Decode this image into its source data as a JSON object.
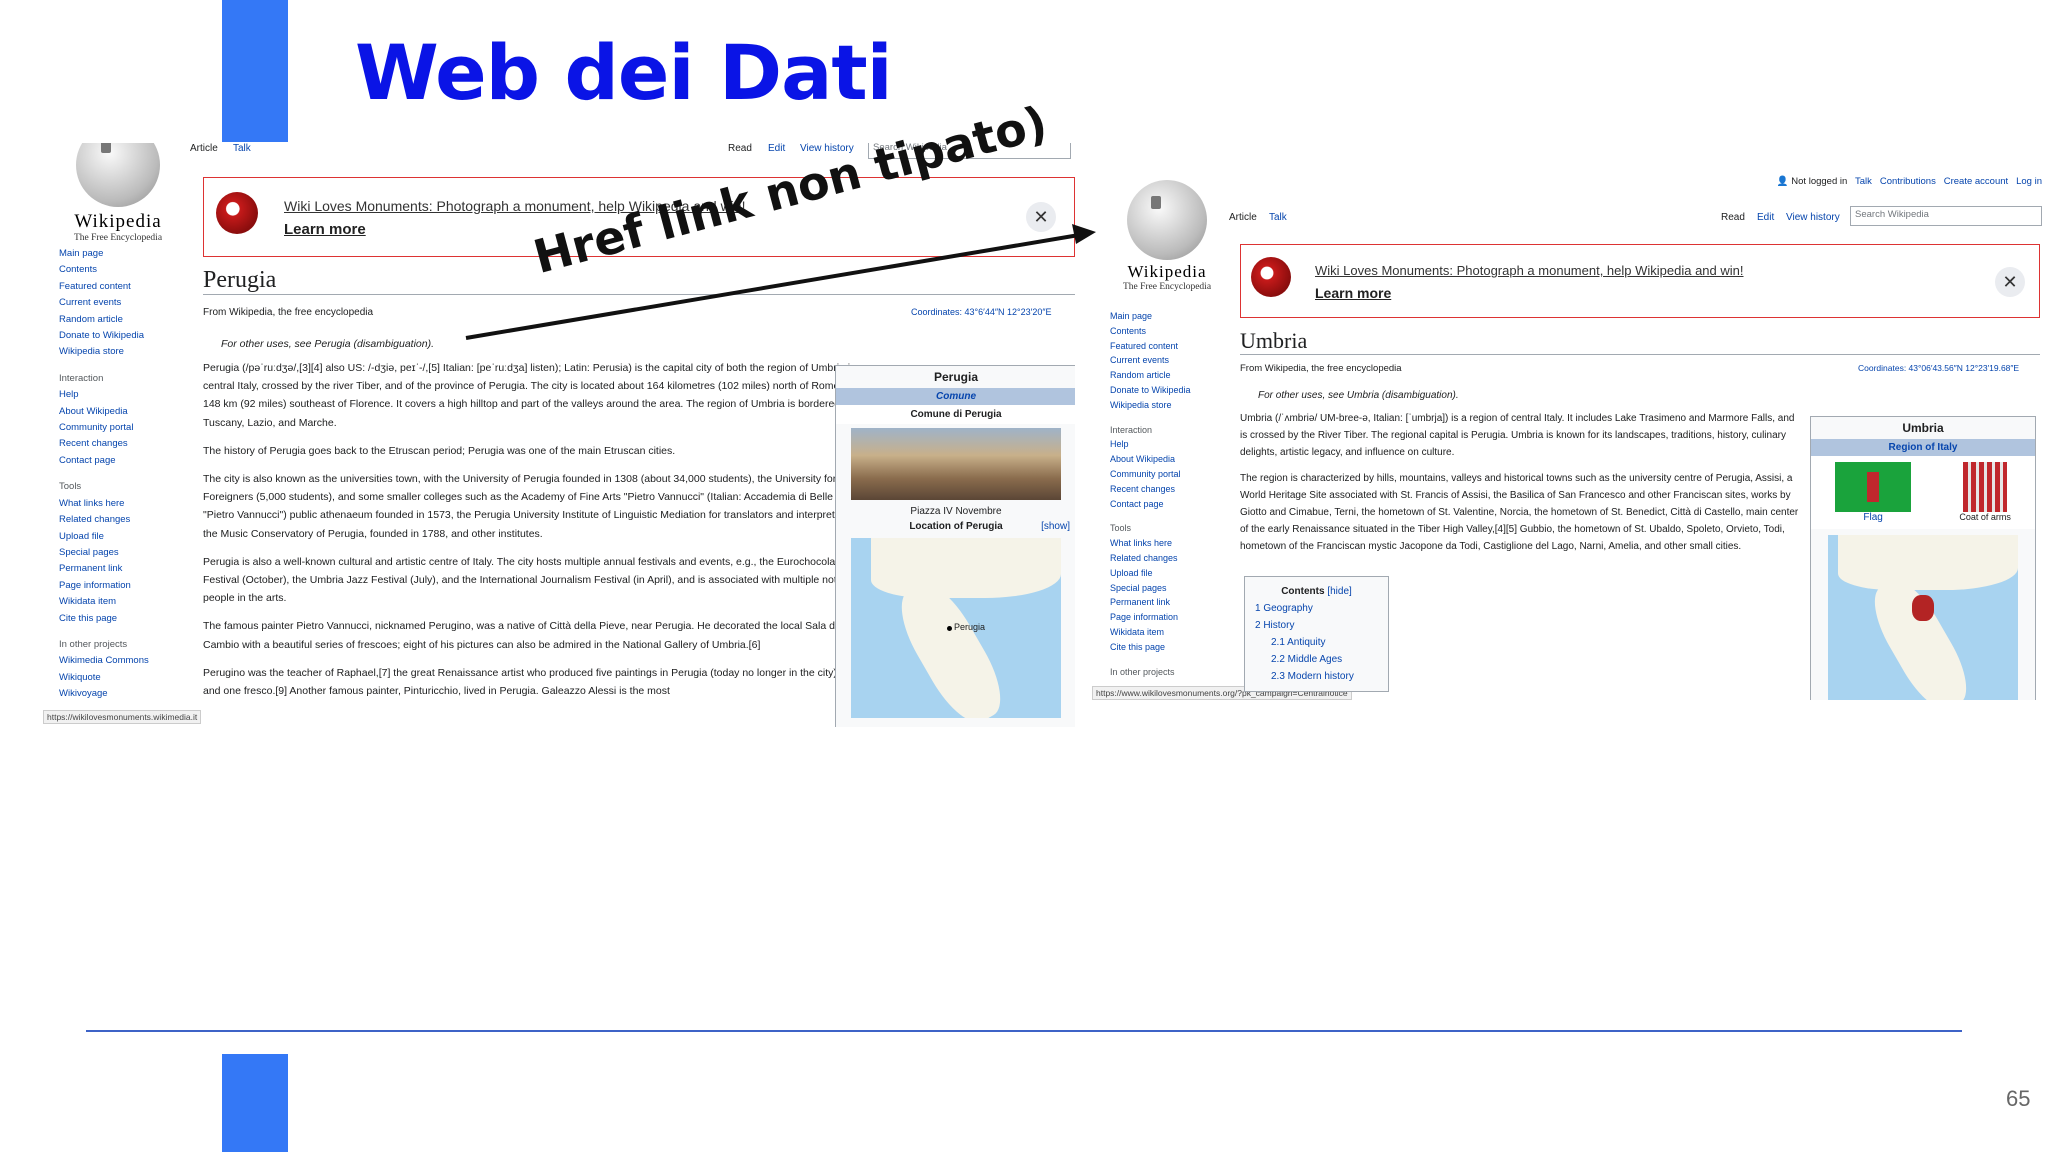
{
  "slide": {
    "title": "Web dei Dati",
    "page_number": "65",
    "annotation": "Href link non tipato)"
  },
  "shotA": {
    "logo": {
      "wordmark": "Wikipedia",
      "tagline": "The Free Encyclopedia"
    },
    "tabs": {
      "article": "Article",
      "talk": "Talk",
      "read": "Read",
      "edit": "Edit",
      "history": "View history",
      "search_placeholder": "Search Wikipedia"
    },
    "nav": [
      "Main page",
      "Contents",
      "Featured content",
      "Current events",
      "Random article",
      "Donate to Wikipedia",
      "Wikipedia store"
    ],
    "interaction_heading": "Interaction",
    "interaction": [
      "Help",
      "About Wikipedia",
      "Community portal",
      "Recent changes",
      "Contact page"
    ],
    "tools_heading": "Tools",
    "tools": [
      "What links here",
      "Related changes",
      "Upload file",
      "Special pages",
      "Permanent link",
      "Page information",
      "Wikidata item",
      "Cite this page"
    ],
    "projects_heading": "In other projects",
    "projects": [
      "Wikimedia Commons",
      "Wikiquote",
      "Wikivoyage"
    ],
    "status_url": "https://wikilovesmonuments.wikimedia.it",
    "banner": {
      "message": "Wiki Loves Monuments: Photograph a monument, help Wikipedia and win!",
      "learn_more": "Learn more",
      "close": "✕"
    },
    "title": "Perugia",
    "from": "From Wikipedia, the free encyclopedia",
    "coords": "Coordinates: 43°6′44″N 12°23′20″E",
    "hatnote": "For other uses, see Perugia (disambiguation).",
    "paragraphs": [
      "Perugia (/pəˈruːdʒə/,[3][4] also US: /-dʒiə, peɪˈ-/,[5] Italian: [peˈruːdʒa] listen); Latin: Perusia) is the capital city of both the region of Umbria in central Italy, crossed by the river Tiber, and of the province of Perugia. The city is located about 164 kilometres (102 miles) north of Rome and 148 km (92 miles) southeast of Florence. It covers a high hilltop and part of the valleys around the area. The region of Umbria is bordered by Tuscany, Lazio, and Marche.",
      "The history of Perugia goes back to the Etruscan period; Perugia was one of the main Etruscan cities.",
      "The city is also known as the universities town, with the University of Perugia founded in 1308 (about 34,000 students), the University for Foreigners (5,000 students), and some smaller colleges such as the Academy of Fine Arts \"Pietro Vannucci\" (Italian: Accademia di Belle Arti \"Pietro Vannucci\") public athenaeum founded in 1573, the Perugia University Institute of Linguistic Mediation for translators and interpreters, the Music Conservatory of Perugia, founded in 1788, and other institutes.",
      "Perugia is also a well-known cultural and artistic centre of Italy. The city hosts multiple annual festivals and events, e.g., the Eurochocolate Festival (October), the Umbria Jazz Festival (July), and the International Journalism Festival (in April), and is associated with multiple notable people in the arts.",
      "The famous painter Pietro Vannucci, nicknamed Perugino, was a native of Città della Pieve, near Perugia. He decorated the local Sala del Cambio with a beautiful series of frescoes; eight of his pictures can also be admired in the National Gallery of Umbria.[6]",
      "Perugino was the teacher of Raphael,[7] the great Renaissance artist who produced five paintings in Perugia (today no longer in the city)[8] and one fresco.[9] Another famous painter, Pinturicchio, lived in Perugia. Galeazzo Alessi is the most"
    ],
    "infobox": {
      "title": "Perugia",
      "subtitle": "Comune",
      "row": "Comune di Perugia",
      "caption": "Piazza IV Novembre",
      "location": "Location of Perugia",
      "show": "[show]",
      "map_label": "Perugia"
    }
  },
  "shotB": {
    "personal": [
      "Not logged in",
      "Talk",
      "Contributions",
      "Create account",
      "Log in"
    ],
    "logo": {
      "wordmark": "Wikipedia",
      "tagline": "The Free Encyclopedia"
    },
    "tabs": {
      "article": "Article",
      "talk": "Talk",
      "read": "Read",
      "edit": "Edit",
      "history": "View history",
      "search_placeholder": "Search Wikipedia"
    },
    "nav": [
      "Main page",
      "Contents",
      "Featured content",
      "Current events",
      "Random article",
      "Donate to Wikipedia",
      "Wikipedia store"
    ],
    "interaction_heading": "Interaction",
    "interaction": [
      "Help",
      "About Wikipedia",
      "Community portal",
      "Recent changes",
      "Contact page"
    ],
    "tools_heading": "Tools",
    "tools": [
      "What links here",
      "Related changes",
      "Upload file",
      "Special pages",
      "Permanent link",
      "Page information",
      "Wikidata item",
      "Cite this page"
    ],
    "projects_heading": "In other projects",
    "status_url": "https://www.wikilovesmonuments.org/?pk_campaign=Centralnotice",
    "banner": {
      "message": "Wiki Loves Monuments: Photograph a monument, help Wikipedia and win!",
      "learn_more": "Learn more",
      "close": "✕"
    },
    "title": "Umbria",
    "from": "From Wikipedia, the free encyclopedia",
    "coords": "Coordinates: 43°06′43.56″N 12°23′19.68″E",
    "hatnote": "For other uses, see Umbria (disambiguation).",
    "paragraphs": [
      "Umbria (/ˈʌmbriə/ UM-bree-ə, Italian: [ˈumbrja]) is a region of central Italy. It includes Lake Trasimeno and Marmore Falls, and is crossed by the River Tiber. The regional capital is Perugia. Umbria is known for its landscapes, traditions, history, culinary delights, artistic legacy, and influence on culture.",
      "The region is characterized by hills, mountains, valleys and historical towns such as the university centre of Perugia, Assisi, a World Heritage Site associated with St. Francis of Assisi, the Basilica of San Francesco and other Franciscan sites, works by Giotto and Cimabue, Terni, the hometown of St. Valentine, Norcia, the hometown of St. Benedict, Città di Castello, main center of the early Renaissance situated in the Tiber High Valley,[4][5] Gubbio, the hometown of St. Ubaldo, Spoleto, Orvieto, Todi, hometown of the Franciscan mystic Jacopone da Todi, Castiglione del Lago, Narni, Amelia, and other small cities."
    ],
    "toc": {
      "title": "Contents",
      "hide": "[hide]",
      "items": [
        "1  Geography",
        "2  History",
        "2.1  Antiquity",
        "2.2  Middle Ages",
        "2.3  Modern history"
      ]
    },
    "infobox": {
      "title": "Umbria",
      "subtitle": "Region of Italy",
      "flag": "Flag",
      "coat": "Coat of arms"
    }
  },
  "colors": {
    "slide_title": "#0a14e6",
    "accent_bar": "#3478f6",
    "link": "#0645ad",
    "banner_border": "#dd3333"
  }
}
